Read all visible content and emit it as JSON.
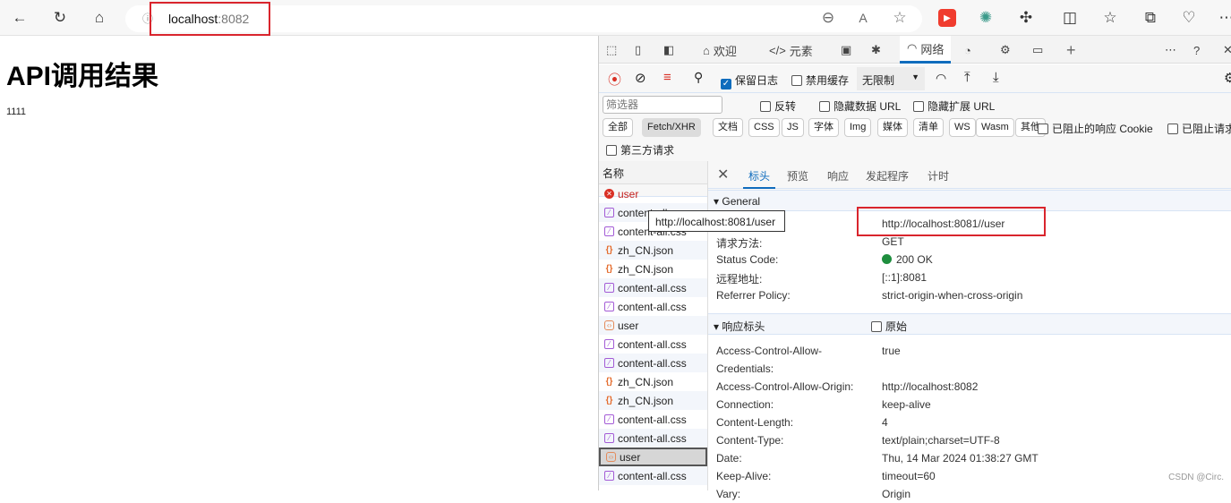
{
  "browser": {
    "address_host": "localhost",
    "address_port": ":8082",
    "icons": [
      "back-icon",
      "refresh-icon",
      "home-icon",
      "info-icon",
      "zoom-out-icon",
      "read-aloud-icon",
      "favorite-star-icon",
      "video-extension-icon",
      "tree-extension-icon",
      "extensions-icon",
      "split-screen-icon",
      "favorites-list-icon",
      "collections-icon",
      "health-icon",
      "more-icon"
    ]
  },
  "page": {
    "title": "API调用结果",
    "body": "1111"
  },
  "devtools": {
    "tabs": [
      {
        "label": "欢迎",
        "icon": "home-icon"
      },
      {
        "label": "元素",
        "icon": "code-icon"
      },
      {
        "label": "",
        "icon": "console-icon"
      },
      {
        "label": "",
        "icon": "bug-icon"
      },
      {
        "label": "网络",
        "icon": "wifi-icon"
      },
      {
        "label": "",
        "icon": "performance-icon"
      },
      {
        "label": "",
        "icon": "cpu-icon"
      },
      {
        "label": "",
        "icon": "application-icon"
      }
    ],
    "toolbar": {
      "preserve_log": "保留日志",
      "preserve_log_checked": true,
      "disable_cache": "禁用缓存",
      "throttle": "无限制"
    },
    "filter": {
      "placeholder": "筛选器",
      "invert": "反转",
      "hide_data_url": "隐藏数据 URL",
      "hide_ext_url": "隐藏扩展 URL",
      "types": [
        "全部",
        "Fetch/XHR",
        "文档",
        "CSS",
        "JS",
        "字体",
        "Img",
        "媒体",
        "清单",
        "WS",
        "Wasm",
        "其他"
      ],
      "selected_type": "Fetch/XHR",
      "blocked_cookie": "已阻止的响应 Cookie",
      "blocked_req": "已阻止请求",
      "third_party": "第三方请求"
    },
    "list": {
      "header": "名称",
      "rows": [
        {
          "name": "user",
          "type": "err"
        },
        {
          "name": "content-all.css",
          "type": "css"
        },
        {
          "name": "content-all.css",
          "type": "css"
        },
        {
          "name": "zh_CN.json",
          "type": "json"
        },
        {
          "name": "zh_CN.json",
          "type": "json"
        },
        {
          "name": "content-all.css",
          "type": "css"
        },
        {
          "name": "content-all.css",
          "type": "css"
        },
        {
          "name": "user",
          "type": "doc"
        },
        {
          "name": "content-all.css",
          "type": "css"
        },
        {
          "name": "content-all.css",
          "type": "css"
        },
        {
          "name": "zh_CN.json",
          "type": "json"
        },
        {
          "name": "zh_CN.json",
          "type": "json"
        },
        {
          "name": "content-all.css",
          "type": "css"
        },
        {
          "name": "content-all.css",
          "type": "css"
        },
        {
          "name": "user",
          "type": "doc",
          "selected": true
        },
        {
          "name": "content-all.css",
          "type": "css"
        }
      ]
    },
    "tooltip": "http://localhost:8081/user",
    "detail_tabs": [
      "标头",
      "预览",
      "响应",
      "发起程序",
      "计时"
    ],
    "general": {
      "title": "General",
      "rows": [
        {
          "k": "",
          "v": "http://localhost:8081//user"
        },
        {
          "k": "请求方法:",
          "v": "GET"
        },
        {
          "k": "Status Code:",
          "v": "200 OK",
          "status": "#1e8e3e"
        },
        {
          "k": "远程地址:",
          "v": "[::1]:8081"
        },
        {
          "k": "Referrer Policy:",
          "v": "strict-origin-when-cross-origin"
        }
      ]
    },
    "response_headers": {
      "title": "响应标头",
      "raw": "原始",
      "rows": [
        {
          "k": "Access-Control-Allow-\nCredentials:",
          "v": "true"
        },
        {
          "k": "Access-Control-Allow-Origin:",
          "v": "http://localhost:8082"
        },
        {
          "k": "Connection:",
          "v": "keep-alive"
        },
        {
          "k": "Content-Length:",
          "v": "4"
        },
        {
          "k": "Content-Type:",
          "v": "text/plain;charset=UTF-8"
        },
        {
          "k": "Date:",
          "v": "Thu, 14 Mar 2024 01:38:27 GMT"
        },
        {
          "k": "Keep-Alive:",
          "v": "timeout=60"
        },
        {
          "k": "Vary:",
          "v": "Origin"
        }
      ]
    }
  },
  "watermark": "CSDN @Circ.",
  "colors": {
    "highlight": "#d9252d",
    "accent": "#0f6cbd"
  }
}
